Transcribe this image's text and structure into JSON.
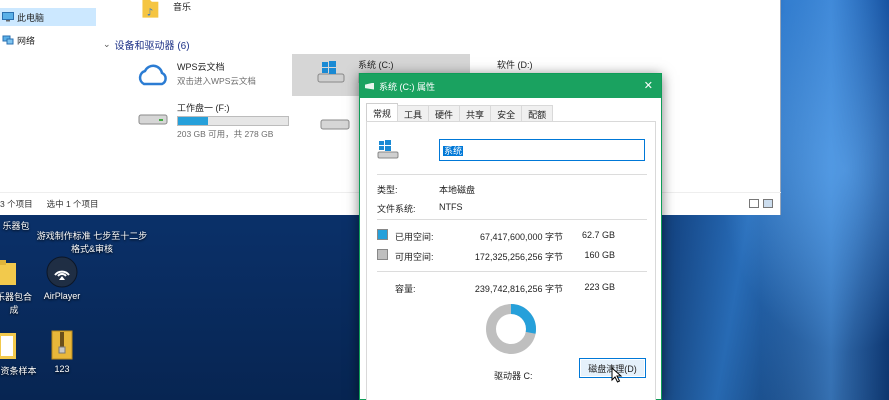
{
  "explorer": {
    "nav": {
      "items": [
        {
          "label": "此电脑",
          "icon": "computer-icon",
          "selected": true
        },
        {
          "label": "网络",
          "icon": "network-icon",
          "selected": false
        }
      ]
    },
    "music_folder": {
      "label": "音乐",
      "icon": "music-folder-icon"
    },
    "devices_group": {
      "label": "设备和驱动器 (6)"
    },
    "devices": [
      {
        "name": "WPS云文档",
        "sub": "双击进入WPS云文档",
        "icon": "wps-cloud-icon",
        "selected": false
      },
      {
        "name": "系统 (C:)",
        "sub": "",
        "icon": "windows-drive-icon",
        "selected": true,
        "used_fraction": 0.28
      },
      {
        "name": "软件 (D:)",
        "sub": "",
        "icon": "drive-icon",
        "selected": false
      },
      {
        "name": "工作盘一 (F:)",
        "sub": "203 GB 可用，共 278 GB",
        "icon": "drive-icon",
        "selected": false,
        "used_fraction": 0.27
      }
    ],
    "status": {
      "count": "3 个项目",
      "selected": "选中 1 个项目"
    }
  },
  "desktop_icons": [
    {
      "label": "乐器包",
      "icon": "folder-icon"
    },
    {
      "label": "游戏制作标准 七步至十二步\n格式&审核",
      "icon": "document-icon"
    },
    {
      "label": "AirPlayer",
      "icon": "airplayer-icon"
    },
    {
      "label": "乐器包合成",
      "icon": "folder-icon"
    },
    {
      "label": "工资条样本",
      "icon": "folder-icon"
    },
    {
      "label": "123",
      "icon": "archive-icon"
    }
  ],
  "dialog": {
    "title": "系统 (C:) 属性",
    "close_icon": "close-icon",
    "tabs": [
      "常规",
      "工具",
      "硬件",
      "共享",
      "安全",
      "配额"
    ],
    "active_tab": "常规",
    "name_value": "系统",
    "type_label": "类型:",
    "type_value": "本地磁盘",
    "fs_label": "文件系统:",
    "fs_value": "NTFS",
    "used": {
      "label": "已用空间:",
      "bytes": "67,417,600,000 字节",
      "size": "62.7 GB",
      "color": "#26a0da"
    },
    "free": {
      "label": "可用空间:",
      "bytes": "172,325,256,256 字节",
      "size": "160 GB",
      "color": "#bfbfbf"
    },
    "capacity": {
      "label": "容量:",
      "bytes": "239,742,816,256 字节",
      "size": "223 GB"
    },
    "used_fraction": 0.28,
    "drive_label": "驱动器 C:",
    "cleanup_button": "磁盘清理(D)"
  }
}
